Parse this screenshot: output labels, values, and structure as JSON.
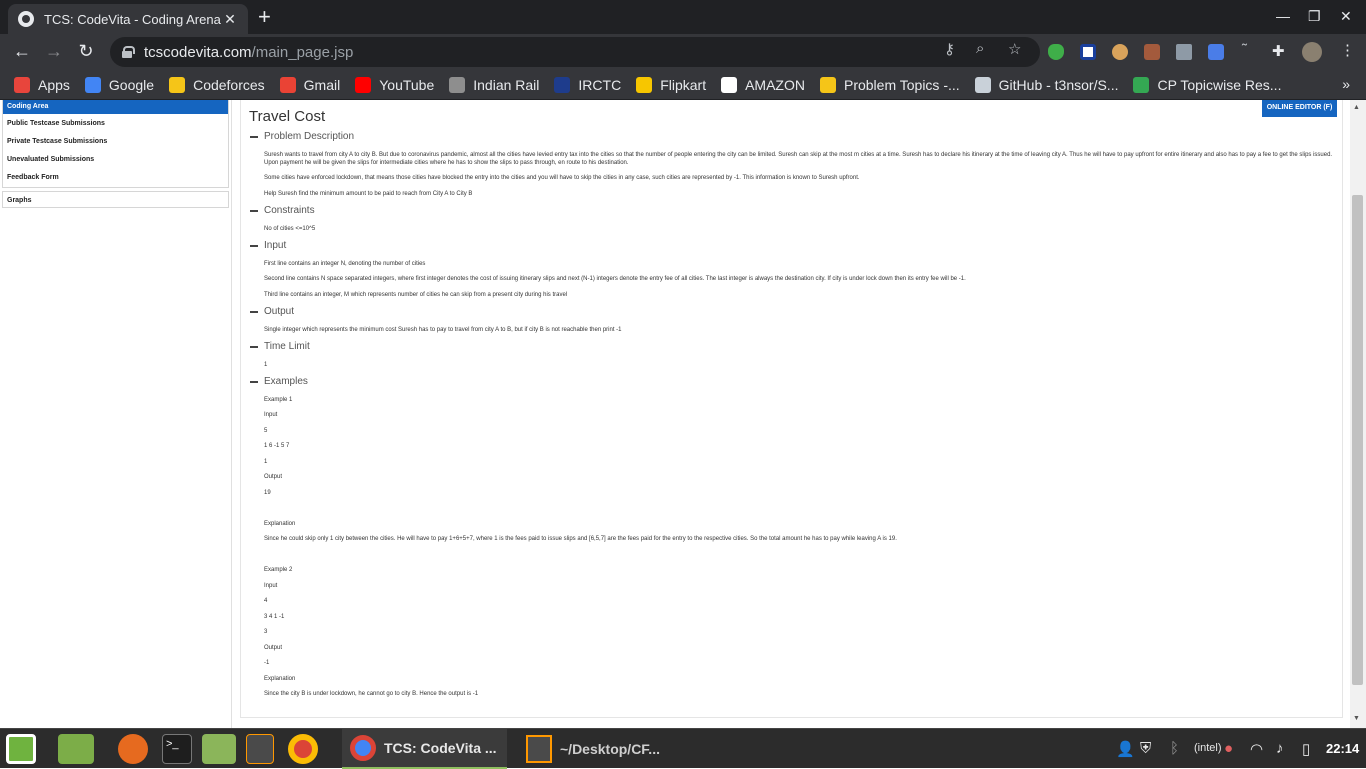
{
  "browser": {
    "tab_title": "TCS: CodeVita - Coding Arena",
    "tab_close": "✕",
    "new_tab": "+",
    "url_host": "tcscodevita.com",
    "url_path": "/main_page.jsp",
    "win_min": "—",
    "win_max": "❐",
    "win_close": "✕"
  },
  "bookmarks": [
    {
      "label": "Apps",
      "color": "#e8453c"
    },
    {
      "label": "Google",
      "color": "#4285f4"
    },
    {
      "label": "Codeforces",
      "color": "#f5c518"
    },
    {
      "label": "Gmail",
      "color": "#ea4335"
    },
    {
      "label": "YouTube",
      "color": "#ff0000"
    },
    {
      "label": "Indian Rail",
      "color": "#8e8e8e"
    },
    {
      "label": "IRCTC",
      "color": "#1e3c8c"
    },
    {
      "label": "Flipkart",
      "color": "#f7c600"
    },
    {
      "label": "AMAZON",
      "color": "#ffffff"
    },
    {
      "label": "Problem Topics -...",
      "color": "#f5c518"
    },
    {
      "label": "GitHub - t3nsor/S...",
      "color": "#c9d1d9"
    },
    {
      "label": "CP Topicwise Res...",
      "color": "#34a853"
    }
  ],
  "bookmarks_more": "»",
  "sidebar": {
    "active": "Coding Area",
    "items": [
      "Public Testcase Submissions",
      "Private Testcase Submissions",
      "Unevaluated Submissions",
      "Feedback Form"
    ],
    "graphs": "Graphs"
  },
  "online_editor": "ONLINE EDITOR (F)",
  "problem": {
    "title": "Travel Cost",
    "sections": {
      "description": "Problem Description",
      "constraints": "Constraints",
      "input": "Input",
      "output": "Output",
      "time_limit": "Time Limit",
      "examples": "Examples"
    },
    "desc_p1": "Suresh wants to travel from city A to city B. But due to coronavirus pandemic, almost all the cities have levied entry tax into the cities so that the number of people entering the city can be limited. Suresh can skip at the most m cities at a time. Suresh has to declare his itinerary at the time of leaving city A. Thus he will have to pay upfront for entire itinerary and also has to pay a fee to get the slips issued. Upon payment he will be given the slips for intermediate cities where he has to show the slips to pass through, en route to his destination.",
    "desc_p2": "Some cities have enforced lockdown, that means those cities have blocked the entry into the cities and you will have to skip the cities in any case, such cities are represented by -1. This information is known to Suresh upfront.",
    "desc_p3": "Help Suresh find the minimum amount to be paid to reach from City A to City B",
    "constraint": "No of cities <=10^5",
    "input_1": "First line contains an integer N, denoting the number of cities",
    "input_2": "Second line contains N space separated integers, where first integer denotes the cost of issuing itinerary slips and next (N-1) integers denote the entry fee of all cities. The last integer is always the destination city. If city is under lock down then its entry fee will be -1.",
    "input_3": "Third line contains an integer, M which represents number of cities he can skip from a present city during his travel",
    "output_1": "Single integer which represents the minimum cost Suresh has to pay to travel from city A to B, but if city B is not reachable then print -1",
    "time_limit": "1",
    "ex1": {
      "title": "Example 1",
      "input_label": "Input",
      "in_1": "5",
      "in_2": "1 6 -1 5 7",
      "in_3": "1",
      "output_label": "Output",
      "out": "19",
      "expl_label": "Explanation",
      "expl": "Since he could skip only 1 city between the cities. He will have to pay 1+6+5+7, where 1 is the fees paid to issue slips and [6,5,7] are the fees paid for the entry to the respective cities. So the total amount he has to pay while leaving A is 19."
    },
    "ex2": {
      "title": "Example 2",
      "input_label": "Input",
      "in_1": "4",
      "in_2": "3 4 1 -1",
      "in_3": "3",
      "output_label": "Output",
      "out": "-1",
      "expl_label": "Explanation",
      "expl": "Since the city B is under lockdown, he cannot go to city B. Hence the output is -1"
    }
  },
  "taskbar": {
    "task_chrome": "TCS: CodeVita ...",
    "task_sublime": "~/Desktop/CF...",
    "clock": "22:14"
  }
}
